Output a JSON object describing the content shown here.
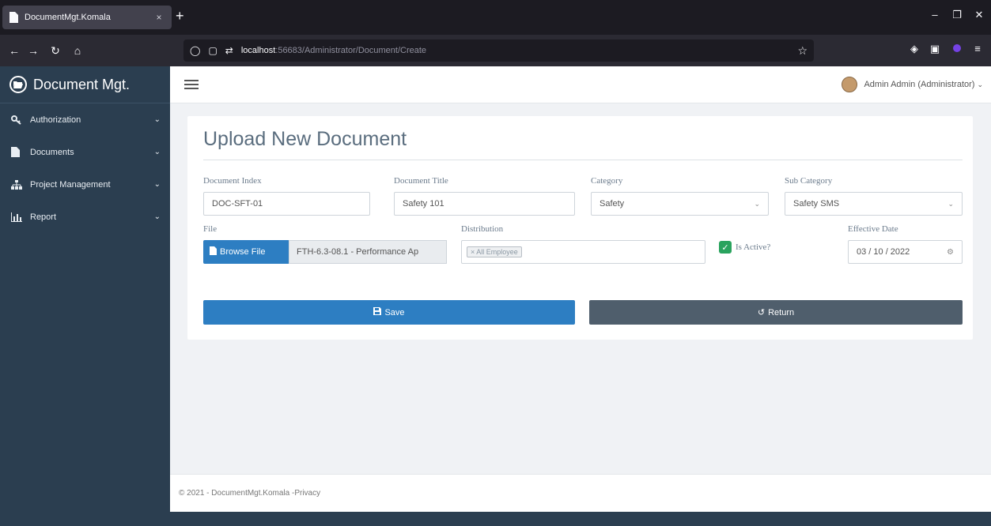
{
  "browser": {
    "tab_title": "DocumentMgt.Komala",
    "tab_close": "×",
    "new_tab": "+",
    "url_host": "localhost",
    "url_path": ":56683/Administrator/Document/Create"
  },
  "app": {
    "brand": "Document Mgt.",
    "user": "Admin Admin (Administrator)",
    "sidebar": [
      {
        "label": "Authorization",
        "icon": "key-icon"
      },
      {
        "label": "Documents",
        "icon": "file-icon"
      },
      {
        "label": "Project Management",
        "icon": "sitemap-icon"
      },
      {
        "label": "Report",
        "icon": "chart-icon"
      }
    ]
  },
  "form": {
    "title": "Upload New Document",
    "document_index": {
      "label": "Document Index",
      "value": "DOC-SFT-01"
    },
    "document_title": {
      "label": "Document Title",
      "value": "Safety 101"
    },
    "category": {
      "label": "Category",
      "value": "Safety"
    },
    "sub_category": {
      "label": "Sub Category",
      "value": "Safety SMS"
    },
    "file": {
      "label": "File",
      "browse_label": "Browse File",
      "file_name": "FTH-6.3-08.1 - Performance Ap"
    },
    "distribution": {
      "label": "Distribution",
      "tag": "× All Employee"
    },
    "is_active": {
      "label": "Is Active?",
      "checked": true
    },
    "effective_date": {
      "label": "Effective Date",
      "value": "03 / 10 / 2022"
    },
    "save_label": "Save",
    "return_label": "Return"
  },
  "footer": {
    "text": "© 2021 - DocumentMgt.Komala - ",
    "privacy": "Privacy"
  },
  "colors": {
    "primary": "#2d7ec2",
    "sidebar": "#2b3e50",
    "success": "#2aa35e",
    "return": "#4f5e6c"
  }
}
